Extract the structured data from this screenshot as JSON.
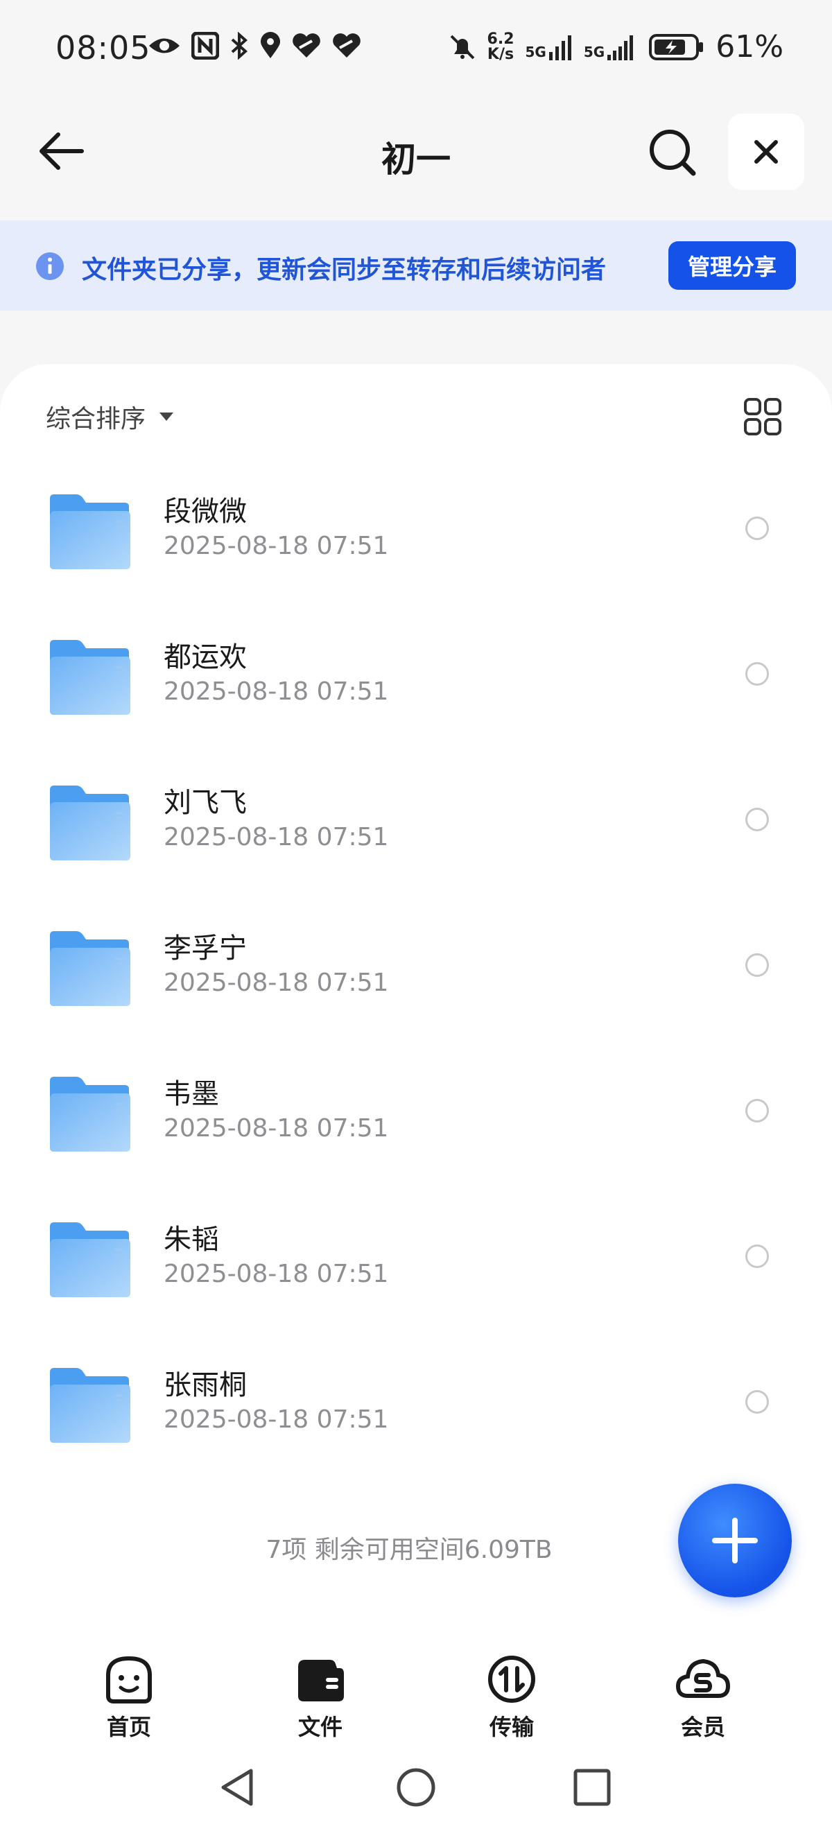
{
  "status_bar": {
    "time": "08:05",
    "net_speed_value": "6.2",
    "net_speed_unit": "K/s",
    "signal1": "5G",
    "signal2": "5G",
    "battery_pct": "61%"
  },
  "header": {
    "title": "初一",
    "back_icon": "arrow-left-icon",
    "search_icon": "search-icon",
    "close_icon": "close-icon"
  },
  "banner": {
    "text": "文件夹已分享，更新会同步至转存和后续访问者",
    "button_label": "管理分享"
  },
  "toolbar": {
    "sort_label": "综合排序",
    "view_icon": "grid-view-icon"
  },
  "files": [
    {
      "name": "段微微",
      "date": "2025-08-18 07:51"
    },
    {
      "name": "都运欢",
      "date": "2025-08-18 07:51"
    },
    {
      "name": "刘飞飞",
      "date": "2025-08-18 07:51"
    },
    {
      "name": "李孚宁",
      "date": "2025-08-18 07:51"
    },
    {
      "name": "韦墨",
      "date": "2025-08-18 07:51"
    },
    {
      "name": "朱韬",
      "date": "2025-08-18 07:51"
    },
    {
      "name": "张雨桐",
      "date": "2025-08-18 07:51"
    }
  ],
  "footer": {
    "info": "7项 剩余可用空间6.09TB"
  },
  "tabs": [
    {
      "label": "首页",
      "icon": "smile-icon"
    },
    {
      "label": "文件",
      "icon": "folder-wallet-icon"
    },
    {
      "label": "传输",
      "icon": "transfer-icon"
    },
    {
      "label": "会员",
      "icon": "cloud-vip-icon"
    }
  ],
  "colors": {
    "accent": "#1552e8",
    "banner_bg": "#e6ecfb",
    "folder": "#5aa6f2"
  }
}
